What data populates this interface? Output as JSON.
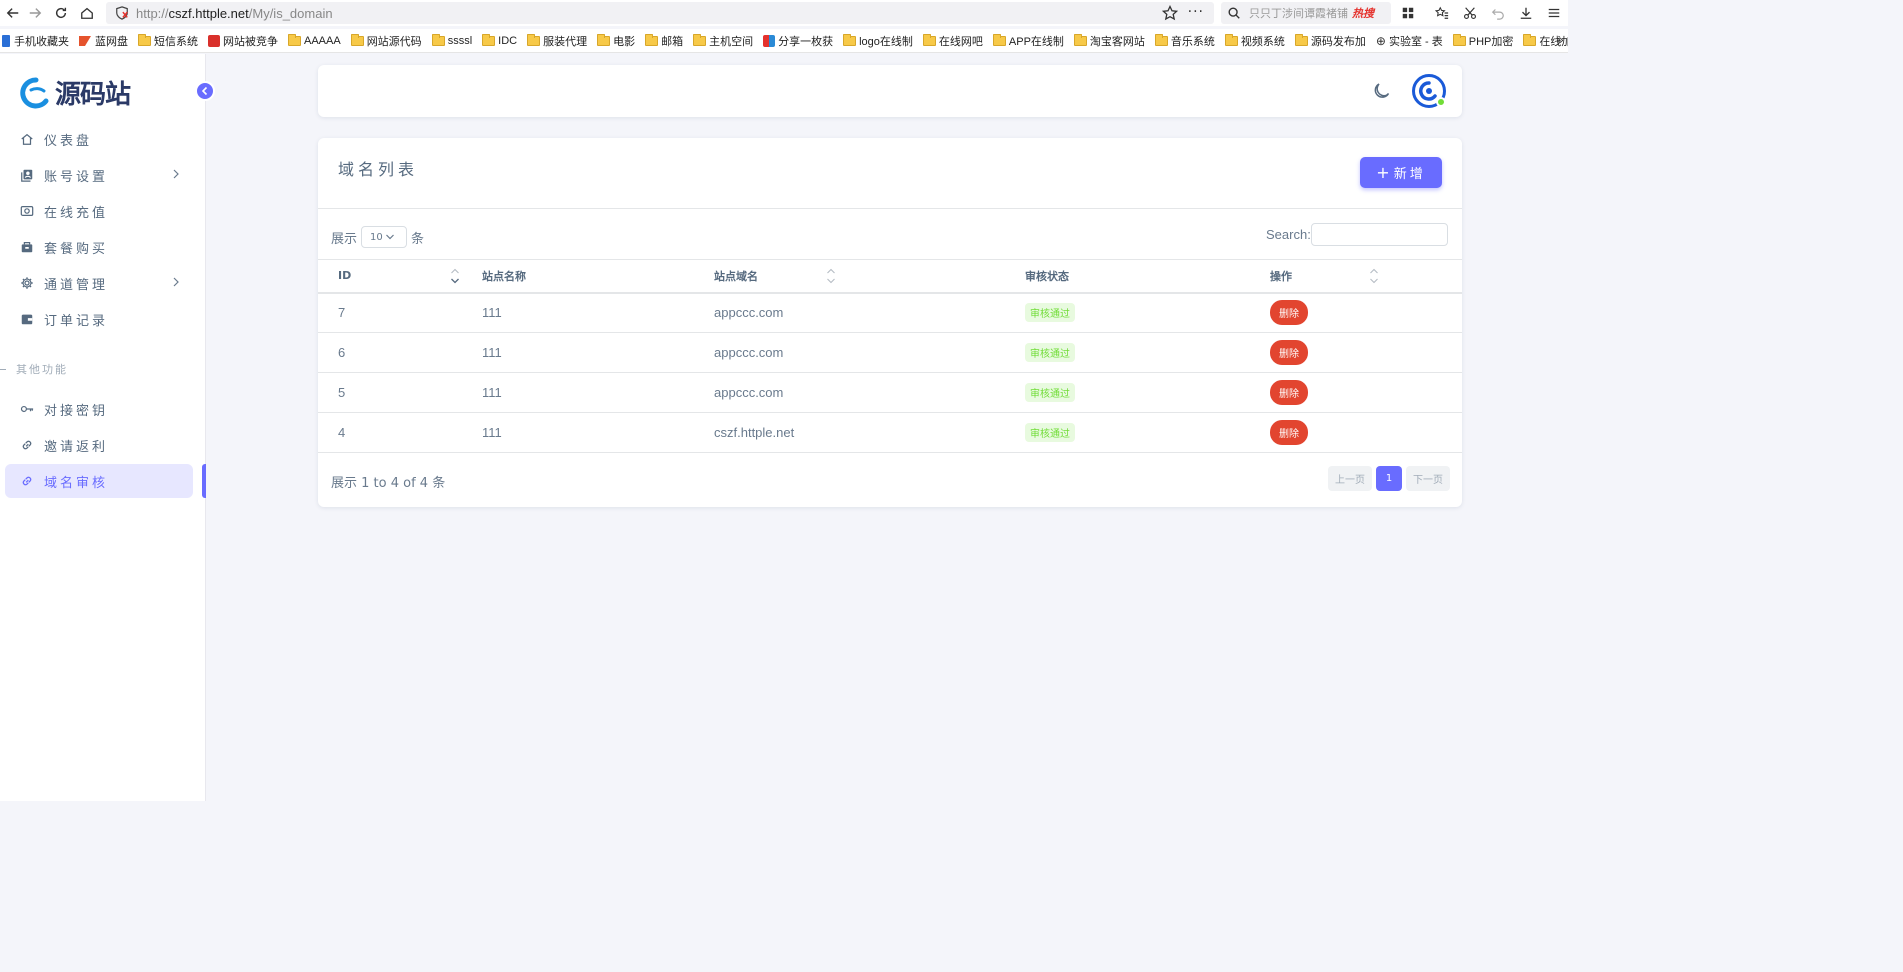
{
  "browser": {
    "url_scheme": "http://",
    "url_host": "cszf.httple.net",
    "url_path": "/My/is_domain",
    "search_placeholder": "只只丁涉间谭霞褚铺",
    "search_hot": "热搜"
  },
  "bookmarks": [
    "手机收藏夹",
    "蓝网盘",
    "短信系统",
    "网站被竞争",
    "AAAAA",
    "网站源代码",
    "ssssl",
    "IDC",
    "服装代理",
    "电影",
    "邮箱",
    "主机空间",
    "分享一枚获",
    "logo在线制",
    "在线网吧",
    "APP在线制",
    "淘宝客网站",
    "音乐系统",
    "视频系统",
    "源码发布加",
    "实验室 - 表",
    "PHP加密",
    "在线加密"
  ],
  "sidebar": {
    "logo_text": "源码站",
    "items": [
      {
        "label": "仪表盘",
        "icon": "home-icon"
      },
      {
        "label": "账号设置",
        "icon": "user-card-icon"
      },
      {
        "label": "在线充值",
        "icon": "camera-icon"
      },
      {
        "label": "套餐购买",
        "icon": "bag-icon"
      },
      {
        "label": "通道管理",
        "icon": "gear-icon"
      },
      {
        "label": "订单记录",
        "icon": "wallet-icon"
      }
    ],
    "section_label": "其他功能",
    "items2": [
      {
        "label": "对接密钥",
        "icon": "key-icon"
      },
      {
        "label": "邀请返利",
        "icon": "link-icon"
      },
      {
        "label": "域名审核",
        "icon": "link-icon"
      }
    ]
  },
  "card": {
    "title": "域名列表",
    "add_label": "新增",
    "length_prefix": "展示",
    "length_value": "10",
    "length_suffix": "条",
    "search_label": "Search:",
    "columns": [
      "ID",
      "站点名称",
      "站点域名",
      "审核状态",
      "操作"
    ],
    "rows": [
      {
        "id": "7",
        "name": "111",
        "domain": "appccc.com",
        "status": "审核通过",
        "action": "删除"
      },
      {
        "id": "6",
        "name": "111",
        "domain": "appccc.com",
        "status": "审核通过",
        "action": "删除"
      },
      {
        "id": "5",
        "name": "111",
        "domain": "appccc.com",
        "status": "审核通过",
        "action": "删除"
      },
      {
        "id": "4",
        "name": "111",
        "domain": "cszf.httple.net",
        "status": "审核通过",
        "action": "删除"
      }
    ],
    "info": "展示 1 to 4 of 4 条",
    "prev_label": "上一页",
    "page": "1",
    "next_label": "下一页"
  },
  "colors": {
    "primary": "#696cff",
    "danger": "#e2452f",
    "success": "#71dd37"
  }
}
